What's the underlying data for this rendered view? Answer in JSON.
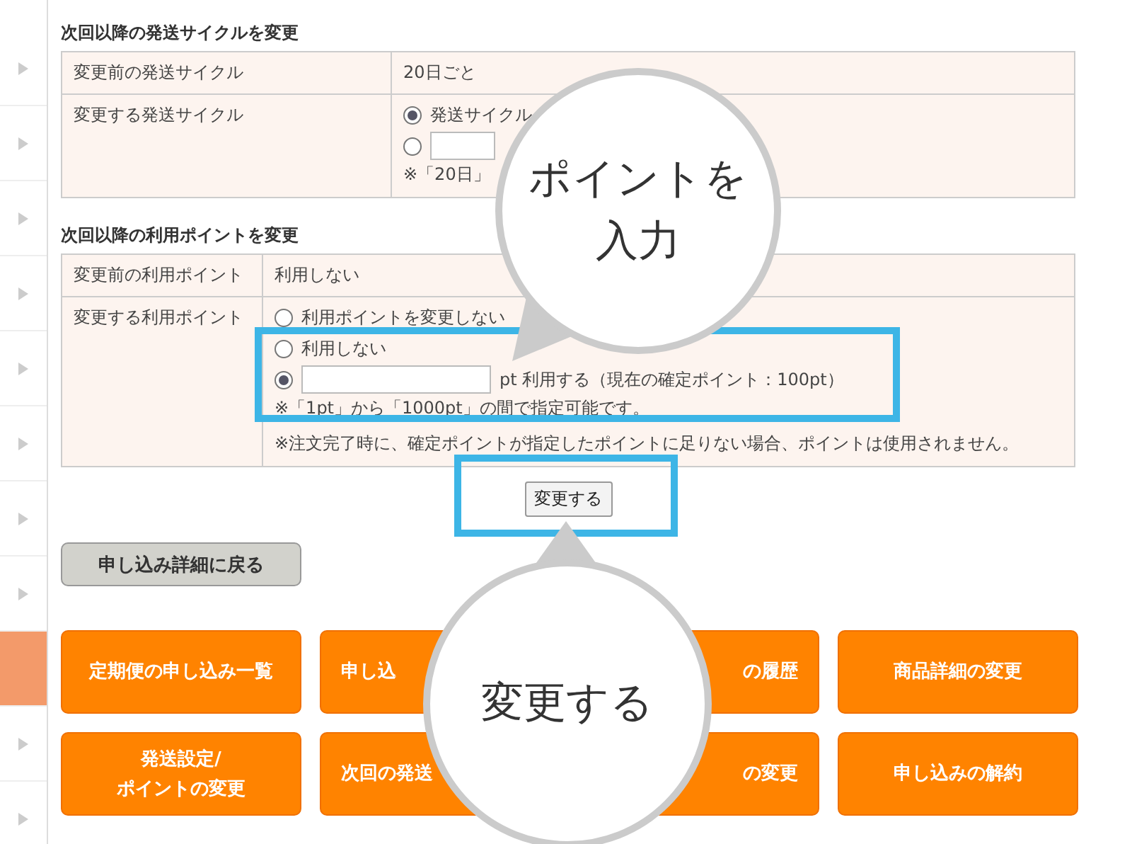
{
  "sidebar": {
    "rows": [
      {
        "selected": false
      },
      {
        "selected": false
      },
      {
        "selected": false
      },
      {
        "selected": false
      },
      {
        "selected": false
      },
      {
        "selected": false
      },
      {
        "selected": false
      },
      {
        "selected": false
      },
      {
        "selected": true
      },
      {
        "selected": false
      },
      {
        "selected": false
      }
    ]
  },
  "sections": [
    {
      "heading": "次回以降の発送サイクルを変更",
      "rows": [
        {
          "kind": "text",
          "label": "変更前の発送サイクル",
          "value": "20日ごと"
        },
        {
          "kind": "options",
          "label": "変更する発送サイクル",
          "options": [
            {
              "kind": "radio",
              "selected": true,
              "label": "発送サイクル"
            },
            {
              "kind": "radio-input",
              "selected": false
            }
          ],
          "notes": [
            "※「20日」"
          ]
        }
      ]
    },
    {
      "heading": "次回以降の利用ポイントを変更",
      "rows": [
        {
          "kind": "text",
          "label": "変更前の利用ポイント",
          "value": "利用しない"
        },
        {
          "kind": "options",
          "label": "変更する利用ポイント",
          "options": [
            {
              "kind": "radio",
              "selected": false,
              "label": "利用ポイントを変更しない"
            },
            {
              "kind": "radio",
              "selected": false,
              "label": "利用しない"
            },
            {
              "kind": "radio-input",
              "selected": true,
              "label": "pt 利用する（現在の確定ポイント：100pt）"
            }
          ],
          "notes": [
            "※「1pt」から「1000pt」の間で指定可能です。",
            "※注文完了時に、確定ポイントが指定したポイントに足りない場合、ポイントは使用されません。"
          ]
        }
      ]
    }
  ],
  "apply_button": "変更する",
  "back_button": "申し込み詳細に戻る",
  "menu_buttons": [
    {
      "lines": [
        "定期便の申し込み一覧"
      ]
    },
    {
      "lines": [
        "申し込"
      ]
    },
    {
      "lines": [
        "の履歴"
      ]
    },
    {
      "lines": [
        "商品詳細の変更"
      ]
    },
    {
      "lines": [
        "発送設定/",
        "ポイントの変更"
      ]
    },
    {
      "lines": [
        "次回の発送"
      ]
    },
    {
      "lines": [
        "の変更"
      ]
    },
    {
      "lines": [
        "申し込みの解約"
      ]
    }
  ],
  "callouts": [
    {
      "lines": [
        "ポイントを",
        "入力"
      ]
    },
    {
      "lines": [
        "変更する"
      ]
    }
  ]
}
